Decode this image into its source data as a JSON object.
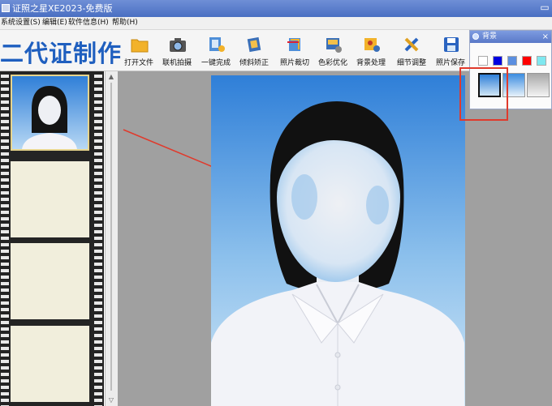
{
  "window": {
    "title": "证照之星XE2023-免费版",
    "minimize_glyph": "▭"
  },
  "menu": [
    "系统设置(S)",
    "编辑(E)",
    "软件信息(H)",
    "帮助(H)"
  ],
  "brand": "二代证制作",
  "toolbar": [
    {
      "label": "打开文件",
      "icon": "folder-icon"
    },
    {
      "label": "联机拍摄",
      "icon": "camera-icon"
    },
    {
      "label": "一键完成",
      "icon": "one-click-icon"
    },
    {
      "label": "倾斜矫正",
      "icon": "tilt-correct-icon"
    },
    {
      "label": "照片裁切",
      "icon": "crop-icon"
    },
    {
      "label": "色彩优化",
      "icon": "color-optimize-icon"
    },
    {
      "label": "背景处理",
      "icon": "background-icon"
    },
    {
      "label": "细节调整",
      "icon": "detail-adjust-icon"
    },
    {
      "label": "照片保存",
      "icon": "save-icon"
    }
  ],
  "background_panel": {
    "title": "背景",
    "close_glyph": "×",
    "colors": [
      "#ffffff",
      "#0000e0",
      "#5b8fe0",
      "#ff0000",
      "#7fe8f0"
    ],
    "gradients": [
      "blue-gradient",
      "light-blue-gradient",
      "gray-gradient"
    ]
  },
  "scrollbar": {
    "up_glyph": "▲",
    "down_glyph": "▽"
  },
  "colors": {
    "accent": "#1f5fbf",
    "photo_bg_top": "#2f7fd8",
    "photo_bg_bottom": "#d0e6f6",
    "highlight": "#e03a2c"
  }
}
